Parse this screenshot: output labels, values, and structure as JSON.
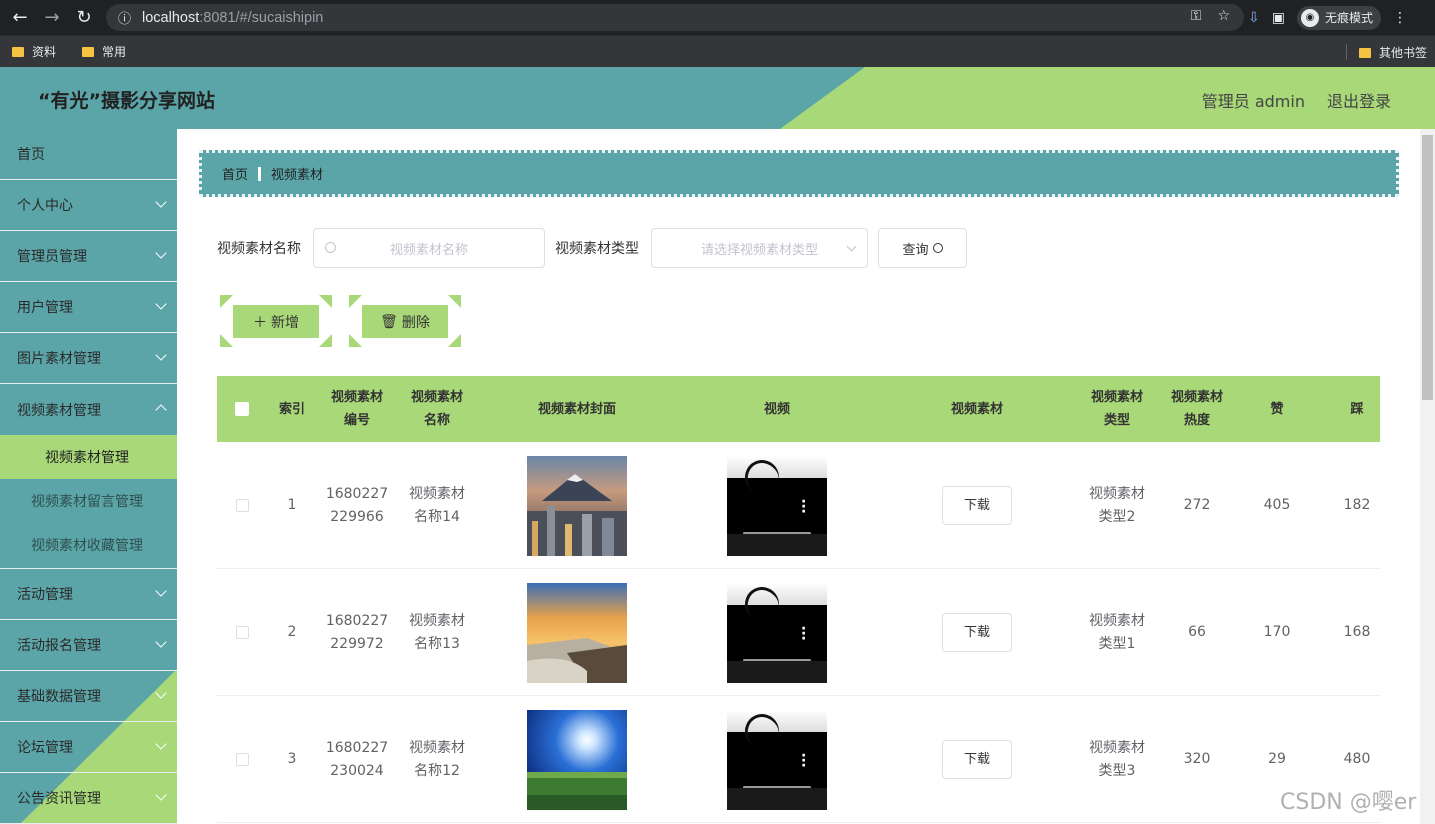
{
  "browser": {
    "url_host": "localhost",
    "url_rest": ":8081/#/sucaishipin",
    "incognito_label": "无痕模式",
    "bookmarks": [
      "资料",
      "常用"
    ],
    "other_bookmarks": "其他书签"
  },
  "header": {
    "title": "“有光”摄影分享网站",
    "admin_label": "管理员 admin",
    "logout_label": "退出登录"
  },
  "sidebar": {
    "items": [
      {
        "label": "首页"
      },
      {
        "label": "个人中心"
      },
      {
        "label": "管理员管理"
      },
      {
        "label": "用户管理"
      },
      {
        "label": "图片素材管理"
      },
      {
        "label": "视频素材管理"
      },
      {
        "label": "活动管理"
      },
      {
        "label": "活动报名管理"
      },
      {
        "label": "基础数据管理"
      },
      {
        "label": "论坛管理"
      },
      {
        "label": "公告资讯管理"
      }
    ],
    "sub_items": [
      {
        "label": "视频素材管理"
      },
      {
        "label": "视频素材留言管理"
      },
      {
        "label": "视频素材收藏管理"
      }
    ]
  },
  "breadcrumb": {
    "home": "首页",
    "current": "视频素材"
  },
  "search": {
    "name_label": "视频素材名称",
    "name_placeholder": "视频素材名称",
    "type_label": "视频素材类型",
    "type_placeholder": "请选择视频素材类型",
    "query_label": "查询"
  },
  "actions": {
    "add_label": "新增",
    "delete_label": "删除"
  },
  "table": {
    "headers": [
      "索引",
      "视频素材编号",
      "视频素材名称",
      "视频素材封面",
      "视频",
      "视频素材",
      "视频素材类型",
      "视频素材热度",
      "赞",
      "踩"
    ],
    "download_label": "下载",
    "rows": [
      {
        "index": "1",
        "code": "1680227229966",
        "name": "视频素材名称14",
        "type": "视频素材类型2",
        "heat": "272",
        "likes": "405",
        "dislikes": "182"
      },
      {
        "index": "2",
        "code": "1680227229972",
        "name": "视频素材名称13",
        "type": "视频素材类型1",
        "heat": "66",
        "likes": "170",
        "dislikes": "168"
      },
      {
        "index": "3",
        "code": "1680227230024",
        "name": "视频素材名称12",
        "type": "视频素材类型3",
        "heat": "320",
        "likes": "29",
        "dislikes": "480"
      }
    ]
  },
  "watermark": "CSDN @嘤er"
}
